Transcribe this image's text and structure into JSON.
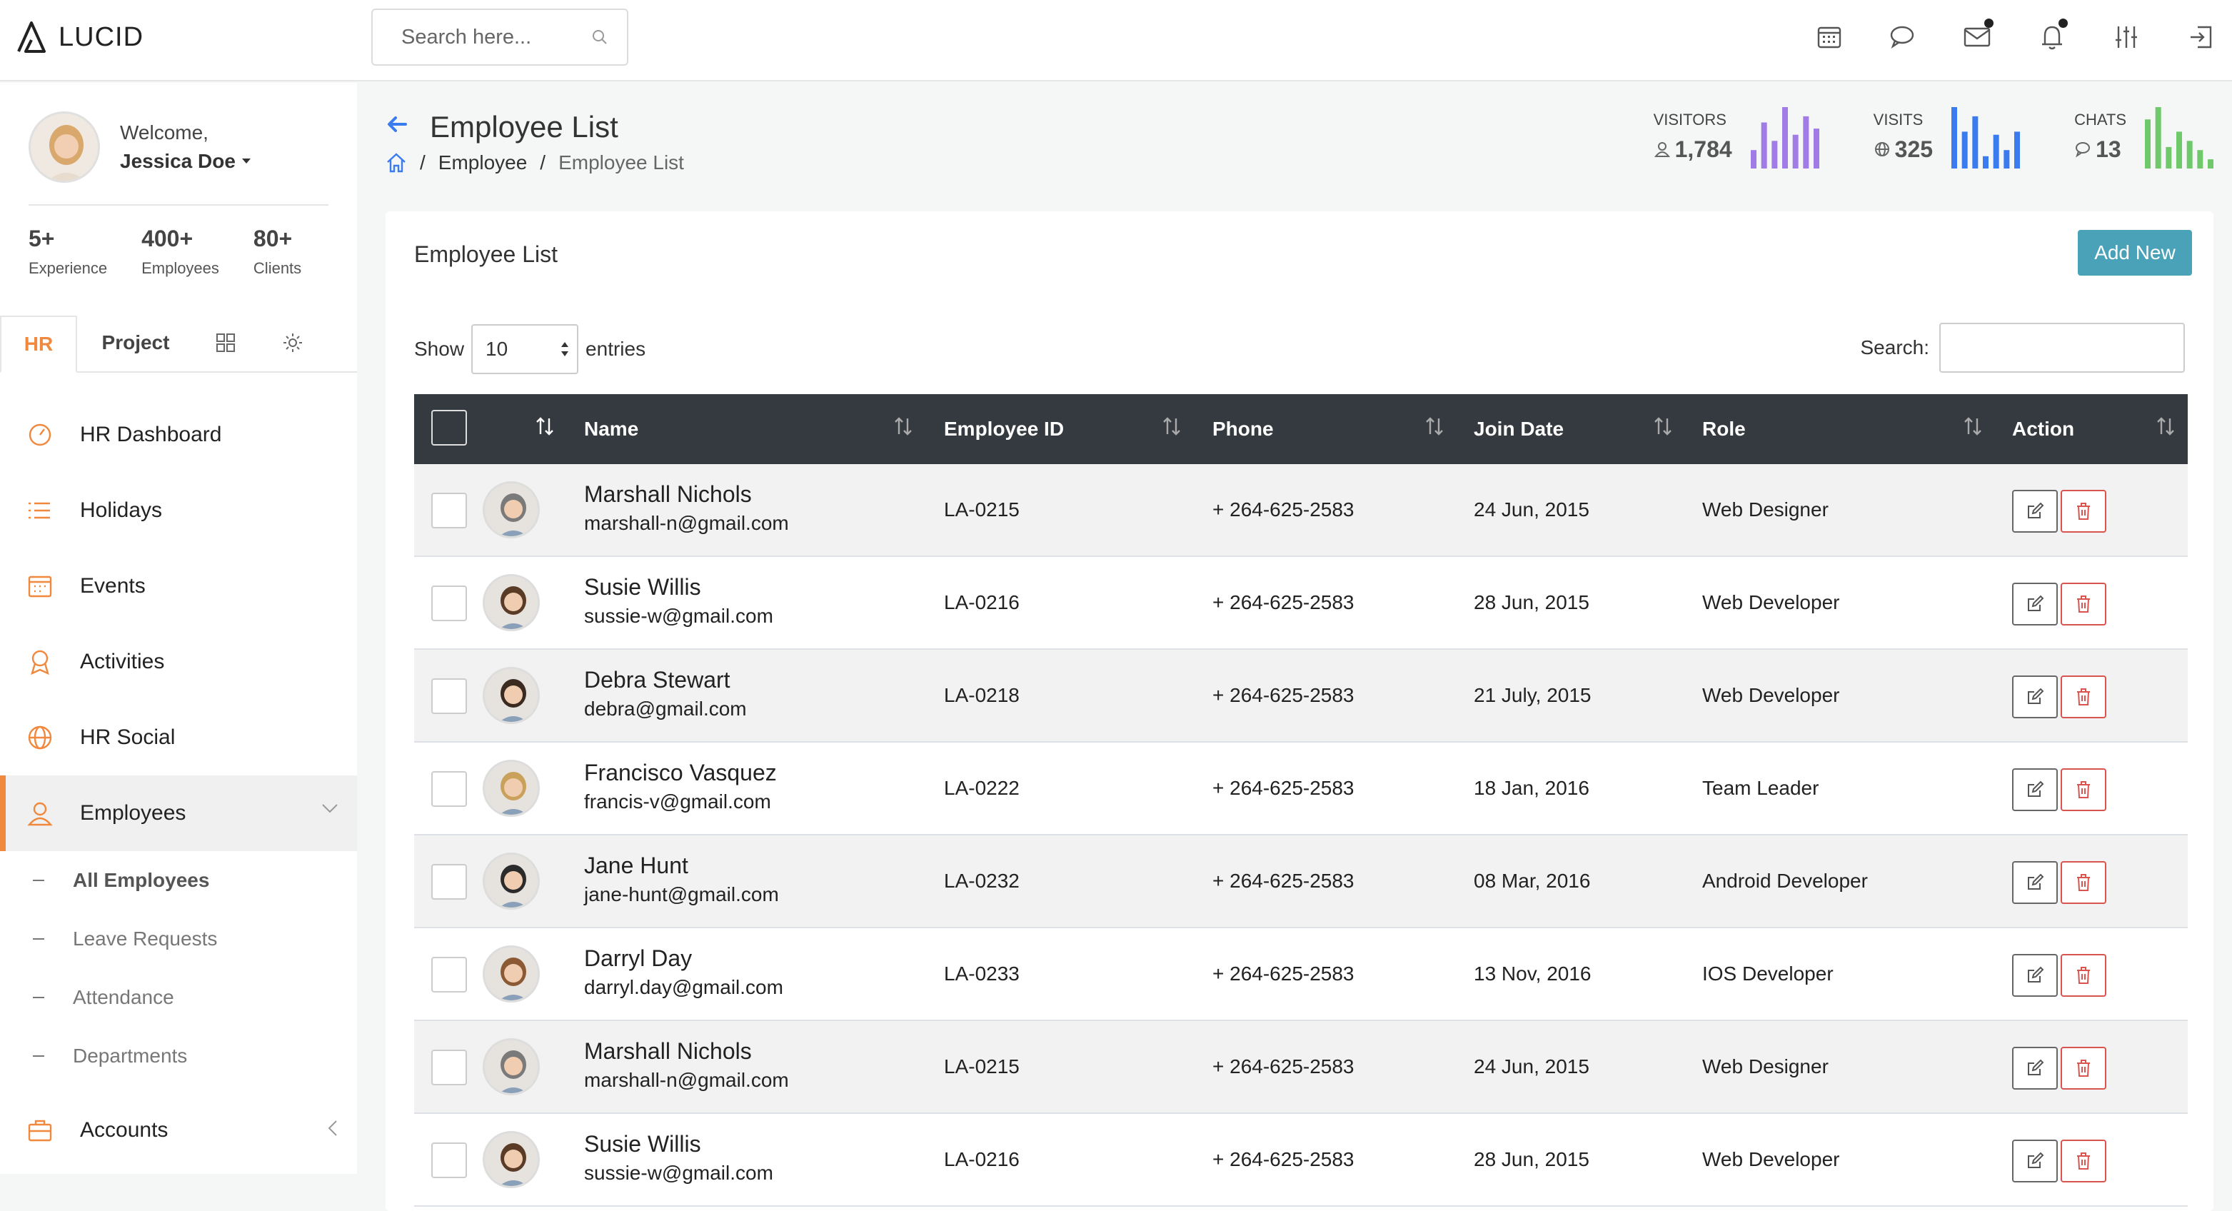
{
  "app": {
    "logo_text": "LUCID"
  },
  "header": {
    "search_placeholder": "Search here..."
  },
  "user": {
    "welcome": "Welcome,",
    "name": "Jessica Doe"
  },
  "stats": [
    {
      "value": "5+",
      "label": "Experience"
    },
    {
      "value": "400+",
      "label": "Employees"
    },
    {
      "value": "80+",
      "label": "Clients"
    }
  ],
  "sidebar_tabs": {
    "hr": "HR",
    "project": "Project"
  },
  "menu": {
    "hr_dashboard": "HR Dashboard",
    "holidays": "Holidays",
    "events": "Events",
    "activities": "Activities",
    "hr_social": "HR Social",
    "employees": "Employees",
    "accounts": "Accounts"
  },
  "submenu": {
    "all_employees": "All Employees",
    "leave_requests": "Leave Requests",
    "attendance": "Attendance",
    "departments": "Departments"
  },
  "page": {
    "title": "Employee List",
    "breadcrumb_1": "Employee",
    "breadcrumb_2": "Employee List"
  },
  "kpis": {
    "visitors": {
      "label": "VISITORS",
      "value": "1,784",
      "color": "#a27ce6",
      "bars": [
        0.3,
        0.75,
        0.45,
        1.0,
        0.55,
        0.85,
        0.65
      ]
    },
    "visits": {
      "label": "VISITS",
      "value": "325",
      "color": "#3a7bf0",
      "bars": [
        1.0,
        0.6,
        0.85,
        0.2,
        0.55,
        0.3,
        0.6
      ]
    },
    "chats": {
      "label": "CHATS",
      "value": "13",
      "color": "#6fc96b",
      "bars": [
        0.8,
        1.0,
        0.35,
        0.6,
        0.45,
        0.3,
        0.15
      ]
    }
  },
  "card": {
    "title": "Employee List",
    "add_new": "Add New",
    "show_label": "Show",
    "entries_value": "10",
    "entries_label": "entries",
    "search_label": "Search:"
  },
  "table": {
    "headers": {
      "name": "Name",
      "employee_id": "Employee ID",
      "phone": "Phone",
      "join_date": "Join Date",
      "role": "Role",
      "action": "Action"
    },
    "rows": [
      {
        "name": "Marshall Nichols",
        "email": "marshall-n@gmail.com",
        "id": "LA-0215",
        "phone": "+ 264-625-2583",
        "date": "24 Jun, 2015",
        "role": "Web Designer"
      },
      {
        "name": "Susie Willis",
        "email": "sussie-w@gmail.com",
        "id": "LA-0216",
        "phone": "+ 264-625-2583",
        "date": "28 Jun, 2015",
        "role": "Web Developer"
      },
      {
        "name": "Debra Stewart",
        "email": "debra@gmail.com",
        "id": "LA-0218",
        "phone": "+ 264-625-2583",
        "date": "21 July, 2015",
        "role": "Web Developer"
      },
      {
        "name": "Francisco Vasquez",
        "email": "francis-v@gmail.com",
        "id": "LA-0222",
        "phone": "+ 264-625-2583",
        "date": "18 Jan, 2016",
        "role": "Team Leader"
      },
      {
        "name": "Jane Hunt",
        "email": "jane-hunt@gmail.com",
        "id": "LA-0232",
        "phone": "+ 264-625-2583",
        "date": "08 Mar, 2016",
        "role": "Android Developer"
      },
      {
        "name": "Darryl Day",
        "email": "darryl.day@gmail.com",
        "id": "LA-0233",
        "phone": "+ 264-625-2583",
        "date": "13 Nov, 2016",
        "role": "IOS Developer"
      },
      {
        "name": "Marshall Nichols",
        "email": "marshall-n@gmail.com",
        "id": "LA-0215",
        "phone": "+ 264-625-2583",
        "date": "24 Jun, 2015",
        "role": "Web Designer"
      },
      {
        "name": "Susie Willis",
        "email": "sussie-w@gmail.com",
        "id": "LA-0216",
        "phone": "+ 264-625-2583",
        "date": "28 Jun, 2015",
        "role": "Web Developer"
      }
    ]
  },
  "colors": {
    "accent": "#f0883e",
    "button": "#49a2b8",
    "table_header": "#343a40",
    "delete": "#d9534f"
  }
}
